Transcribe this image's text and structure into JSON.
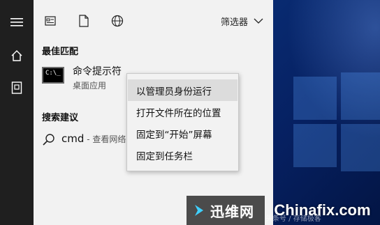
{
  "topbar": {
    "icons": [
      "all-results-icon",
      "documents-icon",
      "web-icon"
    ],
    "filter_label": "筛选器"
  },
  "sections": {
    "best_match": "最佳匹配",
    "suggestions": "搜索建议"
  },
  "best_match": {
    "title": "命令提示符",
    "subtitle": "桌面应用",
    "icon_text": "C:\\_"
  },
  "suggestion": {
    "query": "cmd",
    "rest": " - 查看网络"
  },
  "context_menu": {
    "items": [
      "以管理员身份运行",
      "打开文件所在的位置",
      "固定到“开始”屏幕",
      "固定到任务栏"
    ]
  },
  "watermark": {
    "name": "迅维网",
    "brand": "Chinafix.com",
    "credit": "头条号 / 存储极客"
  },
  "colors": {
    "rail": "#1f1f1f",
    "panel": "#f2f2f2",
    "desktop": "#0a2f78",
    "menu_hover": "#dcdcdc"
  }
}
